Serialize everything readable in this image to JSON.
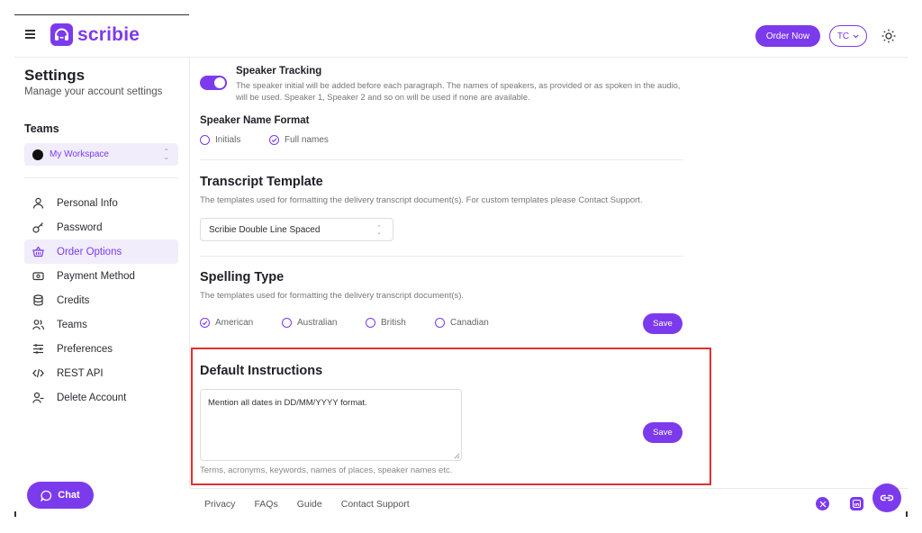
{
  "header": {
    "logo_text": "scribie",
    "order_now_label": "Order Now",
    "user_initials": "TC"
  },
  "sidebar": {
    "title": "Settings",
    "subtitle": "Manage your account settings",
    "teams_heading": "Teams",
    "workspace": "My Workspace",
    "items": [
      {
        "label": "Personal Info",
        "icon": "user-icon"
      },
      {
        "label": "Password",
        "icon": "key-icon"
      },
      {
        "label": "Order Options",
        "icon": "basket-icon",
        "active": true
      },
      {
        "label": "Payment Method",
        "icon": "cash-icon"
      },
      {
        "label": "Credits",
        "icon": "database-icon"
      },
      {
        "label": "Teams",
        "icon": "users-icon"
      },
      {
        "label": "Preferences",
        "icon": "sliders-icon"
      },
      {
        "label": "REST API",
        "icon": "code-icon"
      },
      {
        "label": "Delete Account",
        "icon": "user-minus-icon"
      }
    ],
    "chat_label": "Chat"
  },
  "main": {
    "speaker_tracking": {
      "title": "Speaker Tracking",
      "description": "The speaker initial will be added before each paragraph. The names of speakers, as provided or as spoken in the audio, will be used. Speaker 1, Speaker 2 and so on will be used if none are available.",
      "enabled": true
    },
    "speaker_name_format": {
      "title": "Speaker Name Format",
      "options": [
        "Initials",
        "Full names"
      ],
      "selected": "Full names"
    },
    "transcript_template": {
      "title": "Transcript Template",
      "description": "The templates used for formatting the delivery transcript document(s). For custom templates please Contact Support.",
      "selected": "Scribie Double Line Spaced"
    },
    "spelling_type": {
      "title": "Spelling Type",
      "description": "The templates used for formatting the delivery transcript document(s).",
      "options": [
        "American",
        "Australian",
        "British",
        "Canadian"
      ],
      "selected": "American",
      "save_label": "Save"
    },
    "default_instructions": {
      "title": "Default Instructions",
      "value": "Mention all dates in DD/MM/YYYY format.",
      "hint": "Terms, acronyms, keywords, names of places, speaker names etc.",
      "save_label": "Save"
    }
  },
  "footer": {
    "links": [
      "Privacy",
      "FAQs",
      "Guide",
      "Contact Support"
    ]
  },
  "colors": {
    "accent": "#7c3aed",
    "highlight_border": "#e03030"
  }
}
